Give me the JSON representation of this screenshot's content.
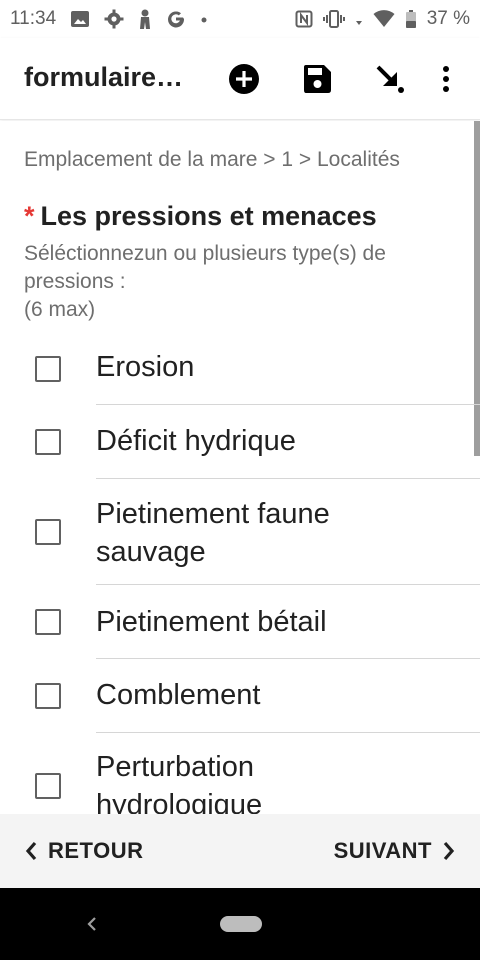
{
  "status_bar": {
    "time": "11:34",
    "battery_percent": "37 %",
    "left_icons": [
      "image-icon",
      "gear-icon",
      "person-icon",
      "google-g-icon",
      "dot-icon"
    ],
    "right_icons": [
      "nfc-icon",
      "vibrate-icon",
      "data-arrows-icon",
      "wifi-icon",
      "battery-icon"
    ]
  },
  "app_bar": {
    "title": "formulaire…",
    "actions": [
      "add-circle-icon",
      "save-icon",
      "go-to-icon",
      "more-vert-icon"
    ]
  },
  "content": {
    "breadcrumb": "Emplacement de la mare > 1 > Localités",
    "question": {
      "required_marker": "*",
      "title": "Les pressions et menaces",
      "hint": "Séléctionnezun ou plusieurs type(s) de pressions :\n(6 max)"
    },
    "options": [
      {
        "label": "Erosion",
        "checked": false
      },
      {
        "label": "Déficit hydrique",
        "checked": false
      },
      {
        "label": "Pietinement faune sauvage",
        "checked": false
      },
      {
        "label": "Pietinement bétail",
        "checked": false
      },
      {
        "label": "Comblement",
        "checked": false
      },
      {
        "label": "Perturbation hydrologique",
        "checked": false
      }
    ]
  },
  "bottom_nav": {
    "back_label": "RETOUR",
    "next_label": "SUIVANT"
  }
}
